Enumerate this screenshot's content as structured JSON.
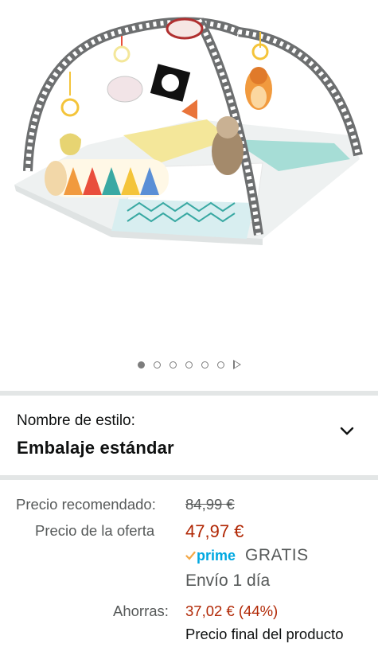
{
  "gallery": {
    "image_alt": "Gimnasio de actividades para bebé con arco y juguetes colgantes",
    "dot_count": 6,
    "active_dot": 0,
    "has_video_icon": true
  },
  "style": {
    "label": "Nombre de estilo:",
    "value": "Embalaje estándar",
    "dropdown_icon": "chevron-down-icon"
  },
  "pricing": {
    "list_label": "Precio recomendado:",
    "list_price": "84,99 €",
    "deal_label": "Precio de la oferta",
    "deal_price": "47,97 €",
    "prime_text": "prime",
    "shipping_free": "GRATIS",
    "shipping_time": "Envío 1 día",
    "savings_label": "Ahorras:",
    "savings_value": "37,02 € (44%)",
    "final_note": "Precio final del producto"
  },
  "colors": {
    "deal": "#b12704",
    "prime": "#00a8e1",
    "separator": "#e3e6e6"
  }
}
